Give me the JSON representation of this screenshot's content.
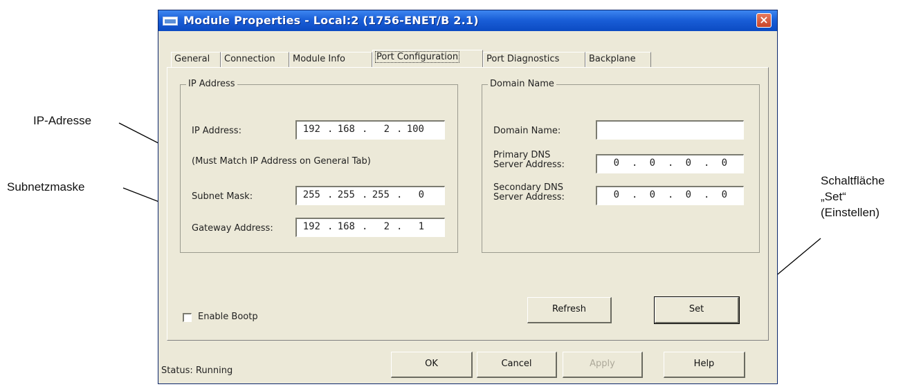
{
  "annotations": {
    "ip_label": "IP-Adresse",
    "subnet_label": "Subnetzmaske",
    "set_label_line1": "Schaltfläche",
    "set_label_line2": "„Set“",
    "set_label_line3": "(Einstellen)"
  },
  "window": {
    "title": "Module Properties - Local:2 (1756-ENET/B 2.1)",
    "close_glyph": "×"
  },
  "tabs": [
    "General",
    "Connection",
    "Module Info",
    "Port Configuration",
    "Port Diagnostics",
    "Backplane"
  ],
  "active_tab": "Port Configuration",
  "ip_group": {
    "title": "IP Address",
    "ip_label": "IP Address:",
    "ip_value": [
      "192",
      "168",
      "2",
      "100"
    ],
    "note": "(Must Match IP Address on General Tab)",
    "subnet_label": "Subnet Mask:",
    "subnet_value": [
      "255",
      "255",
      "255",
      "0"
    ],
    "gateway_label": "Gateway Address:",
    "gateway_value": [
      "192",
      "168",
      "2",
      "1"
    ]
  },
  "domain_group": {
    "title": "Domain Name",
    "domain_label": "Domain Name:",
    "domain_value": "",
    "primary_label_1": "Primary DNS",
    "primary_label_2": "Server Address:",
    "primary_value": [
      "0",
      "0",
      "0",
      "0"
    ],
    "secondary_label_1": "Secondary DNS",
    "secondary_label_2": "Server Address:",
    "secondary_value": [
      "0",
      "0",
      "0",
      "0"
    ]
  },
  "enable_bootp": {
    "label": "Enable Bootp",
    "checked": false
  },
  "buttons": {
    "refresh": "Refresh",
    "set": "Set",
    "ok": "OK",
    "cancel": "Cancel",
    "apply": "Apply",
    "help": "Help"
  },
  "status": "Status:  Running",
  "colors": {
    "title_bar": "#1a5fd8",
    "dialog_bg": "#ece9d8",
    "close_button": "#d9533a"
  }
}
